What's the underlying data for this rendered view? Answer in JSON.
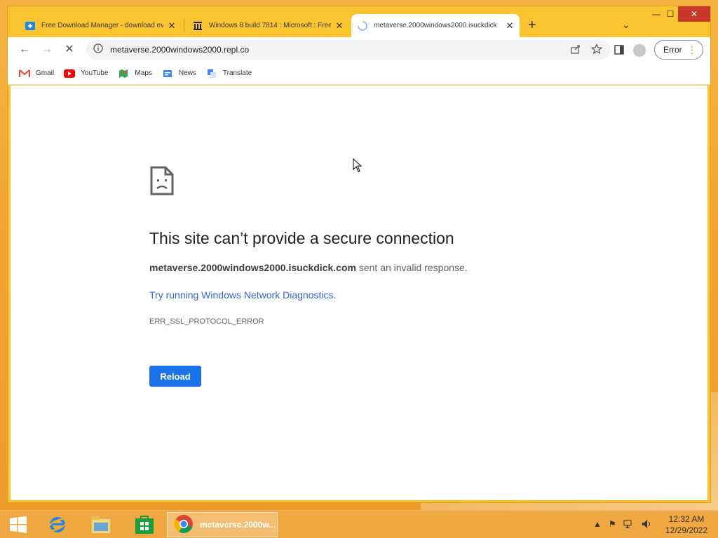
{
  "window": {
    "tabs": [
      {
        "title": "Free Download Manager - download ev",
        "close": "✕"
      },
      {
        "title": "Windows 8 build 7814 : Microsoft : Free",
        "close": "✕"
      },
      {
        "title": "metaverse.2000windows2000.isuckdick",
        "close": "✕"
      }
    ],
    "new_tab": "+",
    "tab_menu": "⌄",
    "controls": {
      "minimize": "—",
      "maximize": "☐",
      "close": "✕"
    }
  },
  "toolbar": {
    "back": "←",
    "forward": "→",
    "stop": "✕",
    "url": "metaverse.2000windows2000.repl.co",
    "error_label": "Error"
  },
  "bookmarks": [
    {
      "label": "Gmail",
      "icon": "gmail-icon"
    },
    {
      "label": "YouTube",
      "icon": "youtube-icon"
    },
    {
      "label": "Maps",
      "icon": "maps-icon"
    },
    {
      "label": "News",
      "icon": "news-icon"
    },
    {
      "label": "Translate",
      "icon": "translate-icon"
    }
  ],
  "error_page": {
    "title": "This site can’t provide a secure connection",
    "host": "metaverse.2000windows2000.isuckdick.com",
    "desc_suffix": " sent an invalid response.",
    "link": "Try running Windows Network Diagnostics.",
    "code": "ERR_SSL_PROTOCOL_ERROR",
    "reload_label": "Reload"
  },
  "taskbar": {
    "chrome_label": "metaverse.2000w...",
    "time": "12:32 AM",
    "date": "12/29/2022"
  },
  "colors": {
    "accent": "#1a73e8",
    "link": "#3367d6",
    "frame": "#f9c42f",
    "close_button": "#c7372b"
  }
}
